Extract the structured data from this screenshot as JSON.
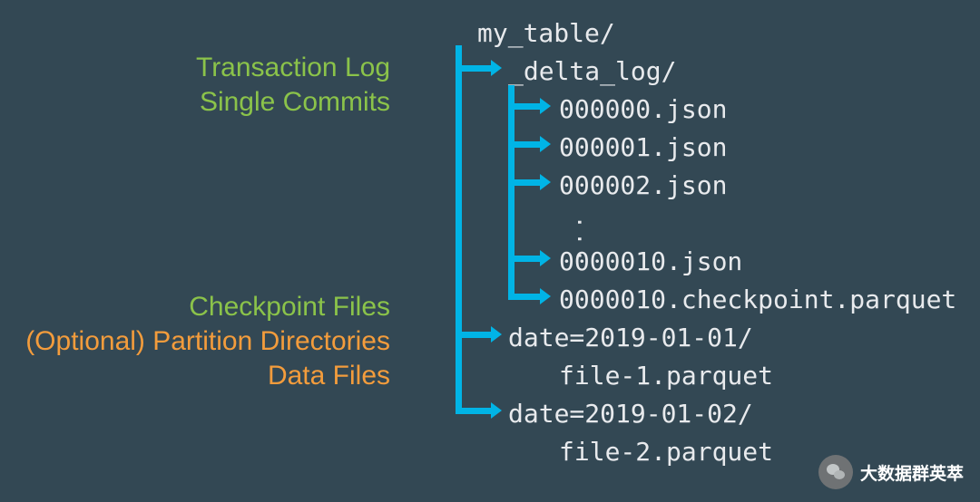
{
  "labels": {
    "transaction_log": "Transaction Log",
    "single_commits": "Single Commits",
    "checkpoint_files": "Checkpoint Files",
    "partition_dirs": "(Optional) Partition Directories",
    "data_files": "Data Files"
  },
  "tree": {
    "root": "my_table/",
    "delta_log_dir": "_delta_log/",
    "commit_0": "000000.json",
    "commit_1": "000001.json",
    "commit_2": "000002.json",
    "ellipsis": "…",
    "commit_10": "0000010.json",
    "checkpoint_10": "0000010.checkpoint.parquet",
    "partition_1": "date=2019-01-01/",
    "file_1": "file-1.parquet",
    "partition_2": "date=2019-01-02/",
    "file_2": "file-2.parquet"
  },
  "watermark": {
    "text": "大数据群英萃"
  },
  "colors": {
    "background": "#334854",
    "arrow": "#00b4e6",
    "green": "#8bc34a",
    "orange": "#f39c3c",
    "tree_text": "#e8eaed"
  }
}
